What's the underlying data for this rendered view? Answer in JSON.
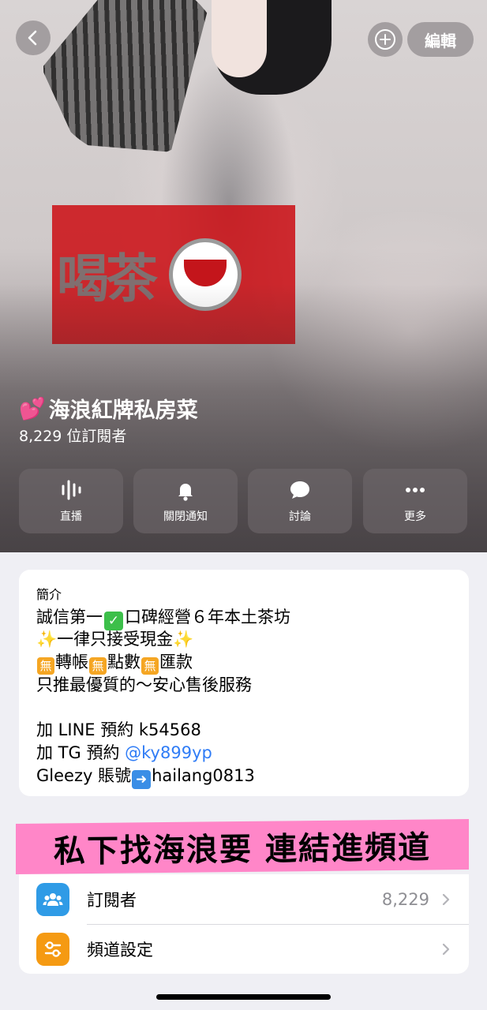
{
  "header": {
    "back_icon": "chevron-left-icon",
    "add_icon": "plus-circle-icon",
    "edit_label": "編輯"
  },
  "hero": {
    "logo_text": "喝茶",
    "logo_color": "#cc1218"
  },
  "channel": {
    "emoji": "💕",
    "title": "海浪紅牌私房菜",
    "subscribers": "8,229 位訂閱者"
  },
  "actions": [
    {
      "label": "直播",
      "icon": "live-waveform-icon"
    },
    {
      "label": "關閉通知",
      "icon": "bell-icon"
    },
    {
      "label": "討論",
      "icon": "chat-bubble-icon"
    },
    {
      "label": "更多",
      "icon": "more-dots-icon"
    }
  ],
  "about": {
    "label": "簡介",
    "line1_a": "誠信第一",
    "line1_b": "口碑經營６年本土茶坊",
    "line2": "一律只接受現金",
    "line3_a": "轉帳",
    "line3_b": "點數",
    "line3_c": "匯款",
    "badge_char": "無",
    "line4": "只推最優質的～安心售後服務",
    "line5": "加 LINE 預約 k54568",
    "line6_prefix": "加 TG 預約 ",
    "line6_link": "@ky899yp",
    "line7_a": "Gleezy 賬號",
    "line7_b": "hailang0813"
  },
  "banner": {
    "text": "私下找海浪要 連結進頻道",
    "color": "#ff86c8"
  },
  "list": [
    {
      "label": "訂閱者",
      "value": "8,229",
      "icon": "people-icon",
      "color": "#2f9be6"
    },
    {
      "label": "頻道設定",
      "value": "",
      "icon": "settings-sliders-icon",
      "color": "#f59a12"
    }
  ]
}
